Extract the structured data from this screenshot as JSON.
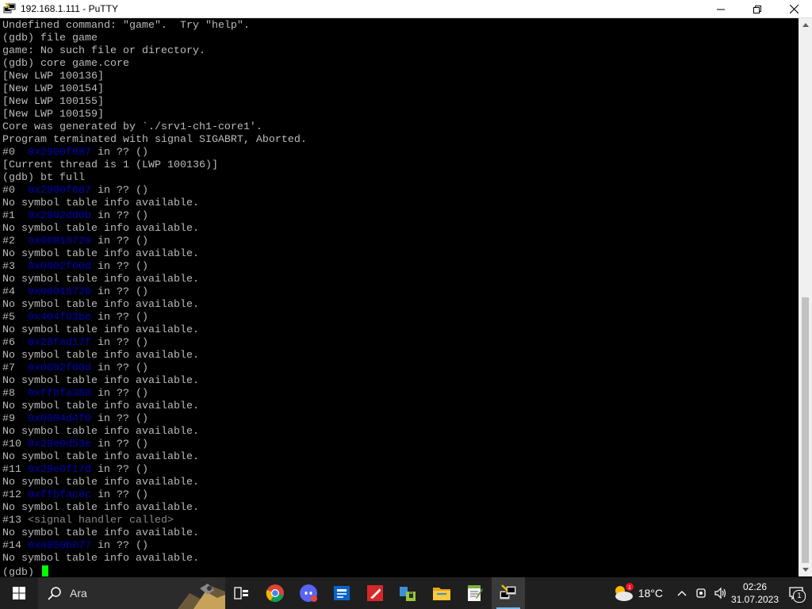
{
  "window": {
    "title": "192.168.1.111 - PuTTY"
  },
  "terminal": {
    "lines": [
      [
        {
          "t": "Undefined command: \"game\".  Try \"help\"."
        }
      ],
      [
        {
          "t": "(gdb) file game"
        }
      ],
      [
        {
          "t": "game: No such file or directory."
        }
      ],
      [
        {
          "t": "(gdb) core game.core"
        }
      ],
      [
        {
          "t": "[New LWP 100136]"
        }
      ],
      [
        {
          "t": "[New LWP 100154]"
        }
      ],
      [
        {
          "t": "[New LWP 100155]"
        }
      ],
      [
        {
          "t": "[New LWP 100159]"
        }
      ],
      [
        {
          "t": "Core was generated by `./srv1-ch1-core1'."
        }
      ],
      [
        {
          "t": "Program terminated with signal SIGABRT, Aborted."
        }
      ],
      [
        {
          "t": "#0  "
        },
        {
          "t": "0x2900f687",
          "c": "addr"
        },
        {
          "t": " in ?? ()"
        }
      ],
      [
        {
          "t": "[Current thread is 1 (LWP 100136)]"
        }
      ],
      [
        {
          "t": "(gdb) bt full"
        }
      ],
      [
        {
          "t": "#0  "
        },
        {
          "t": "0x2900f687",
          "c": "addr"
        },
        {
          "t": " in ?? ()"
        }
      ],
      [
        {
          "t": "No symbol table info available."
        }
      ],
      [
        {
          "t": "#1  "
        },
        {
          "t": "0x2902dd0b",
          "c": "addr"
        },
        {
          "t": " in ?? ()"
        }
      ],
      [
        {
          "t": "No symbol table info available."
        }
      ],
      [
        {
          "t": "#2  "
        },
        {
          "t": "0x00018720",
          "c": "addr"
        },
        {
          "t": " in ?? ()"
        }
      ],
      [
        {
          "t": "No symbol table info available."
        }
      ],
      [
        {
          "t": "#3  "
        },
        {
          "t": "0x0002f00d",
          "c": "addr"
        },
        {
          "t": " in ?? ()"
        }
      ],
      [
        {
          "t": "No symbol table info available."
        }
      ],
      [
        {
          "t": "#4  "
        },
        {
          "t": "0x00018720",
          "c": "addr"
        },
        {
          "t": " in ?? ()"
        }
      ],
      [
        {
          "t": "No symbol table info available."
        }
      ],
      [
        {
          "t": "#5  "
        },
        {
          "t": "0x404f03be",
          "c": "addr"
        },
        {
          "t": " in ?? ()"
        }
      ],
      [
        {
          "t": "No symbol table info available."
        }
      ],
      [
        {
          "t": "#6  "
        },
        {
          "t": "0x28fad17f",
          "c": "addr"
        },
        {
          "t": " in ?? ()"
        }
      ],
      [
        {
          "t": "No symbol table info available."
        }
      ],
      [
        {
          "t": "#7  "
        },
        {
          "t": "0x0002f00d",
          "c": "addr"
        },
        {
          "t": " in ?? ()"
        }
      ],
      [
        {
          "t": "No symbol table info available."
        }
      ],
      [
        {
          "t": "#8  "
        },
        {
          "t": "0xffbfa380",
          "c": "addr"
        },
        {
          "t": " in ?? ()"
        }
      ],
      [
        {
          "t": "No symbol table info available."
        }
      ],
      [
        {
          "t": "#9  "
        },
        {
          "t": "0x0004d4f0",
          "c": "addr"
        },
        {
          "t": " in ?? ()"
        }
      ],
      [
        {
          "t": "No symbol table info available."
        }
      ],
      [
        {
          "t": "#10 "
        },
        {
          "t": "0x29e0d53e",
          "c": "addr"
        },
        {
          "t": " in ?? ()"
        }
      ],
      [
        {
          "t": "No symbol table info available."
        }
      ],
      [
        {
          "t": "#11 "
        },
        {
          "t": "0x29e0f17d",
          "c": "addr"
        },
        {
          "t": " in ?? ()"
        }
      ],
      [
        {
          "t": "No symbol table info available."
        }
      ],
      [
        {
          "t": "#12 "
        },
        {
          "t": "0xffbfac8c",
          "c": "addr"
        },
        {
          "t": " in ?? ()"
        }
      ],
      [
        {
          "t": "No symbol table info available."
        }
      ],
      [
        {
          "t": "#13 "
        },
        {
          "t": "<signal handler called>",
          "c": "dim"
        }
      ],
      [
        {
          "t": "No symbol table info available."
        }
      ],
      [
        {
          "t": "#14 "
        },
        {
          "t": "0x0050b077",
          "c": "addr"
        },
        {
          "t": " in ?? ()"
        }
      ],
      [
        {
          "t": "No symbol table info available."
        }
      ],
      [
        {
          "t": "(gdb) "
        }
      ]
    ],
    "colors": {
      "text": "#bbbbbb",
      "address": "#0000bb",
      "cursor": "#00ff00",
      "background": "#000000"
    }
  },
  "taskbar": {
    "search_placeholder": "Ara",
    "apps": [
      "task-view",
      "chrome",
      "discord",
      "outlook",
      "app-red",
      "app-lock",
      "file-explorer",
      "notepad-plus",
      "putty"
    ],
    "weather": {
      "temp": "18°C"
    },
    "clock": {
      "time": "02:26",
      "date": "31.07.2023"
    },
    "notification_count": "1"
  }
}
